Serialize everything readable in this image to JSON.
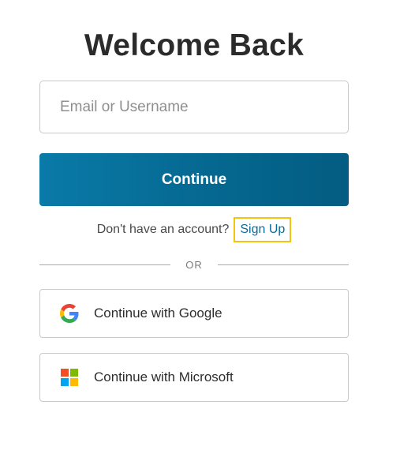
{
  "header": {
    "title": "Welcome Back"
  },
  "login_form": {
    "email_placeholder": "Email or Username",
    "email_value": "",
    "continue_label": "Continue"
  },
  "signup": {
    "prompt": "Don't have an account?",
    "link_label": "Sign Up"
  },
  "divider": {
    "label": "OR"
  },
  "social": {
    "google": {
      "label": "Continue with Google",
      "icon": "google-icon"
    },
    "microsoft": {
      "label": "Continue with Microsoft",
      "icon": "microsoft-icon"
    }
  },
  "colors": {
    "primary_button": "#056890",
    "link": "#0a6c9a",
    "focus_outline": "#f2c40f",
    "ms_red": "#f25022",
    "ms_green": "#7fba00",
    "ms_blue": "#00a4ef",
    "ms_yellow": "#ffb900"
  }
}
